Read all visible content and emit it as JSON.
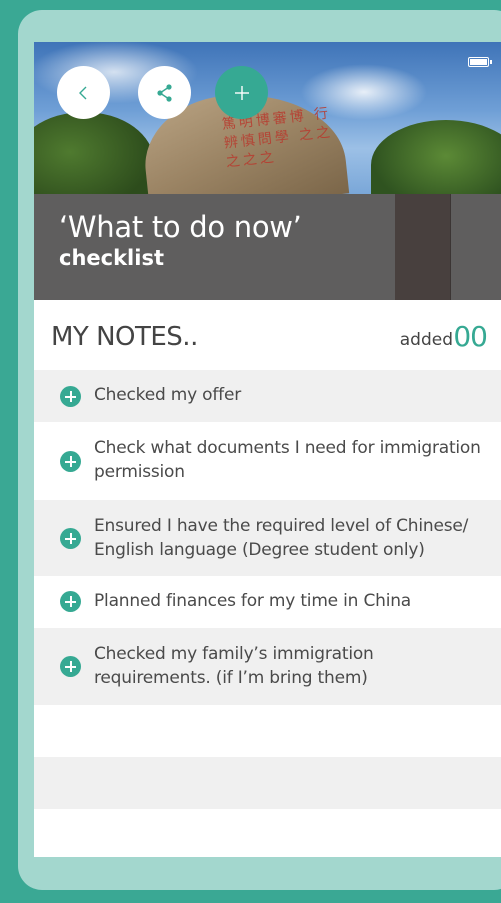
{
  "header": {
    "title_line1": "‘What to do now’",
    "title_line2": "checklist"
  },
  "hero": {
    "inscription": "篤明博審博 行辨慎問學 之之之之之"
  },
  "icons": {
    "back": "chevron-left-icon",
    "share": "share-icon",
    "add": "plus-icon",
    "battery": "battery-icon"
  },
  "colors": {
    "accent": "#36a993",
    "title_panel": "#5f5e5e",
    "background": "#3aa894",
    "frame": "#a3d7ce"
  },
  "notes": {
    "title": "MY NOTES..",
    "added_label": "added",
    "added_count": "00"
  },
  "checklist": [
    {
      "label": "Checked my offer"
    },
    {
      "label": "Check what documents I need for immigration permission"
    },
    {
      "label": "Ensured I have the required level of Chinese/ English language (Degree student only)"
    },
    {
      "label": "Planned finances for my time in China"
    },
    {
      "label": "Checked my family’s immigration requirements. (if I’m bring them)"
    }
  ]
}
